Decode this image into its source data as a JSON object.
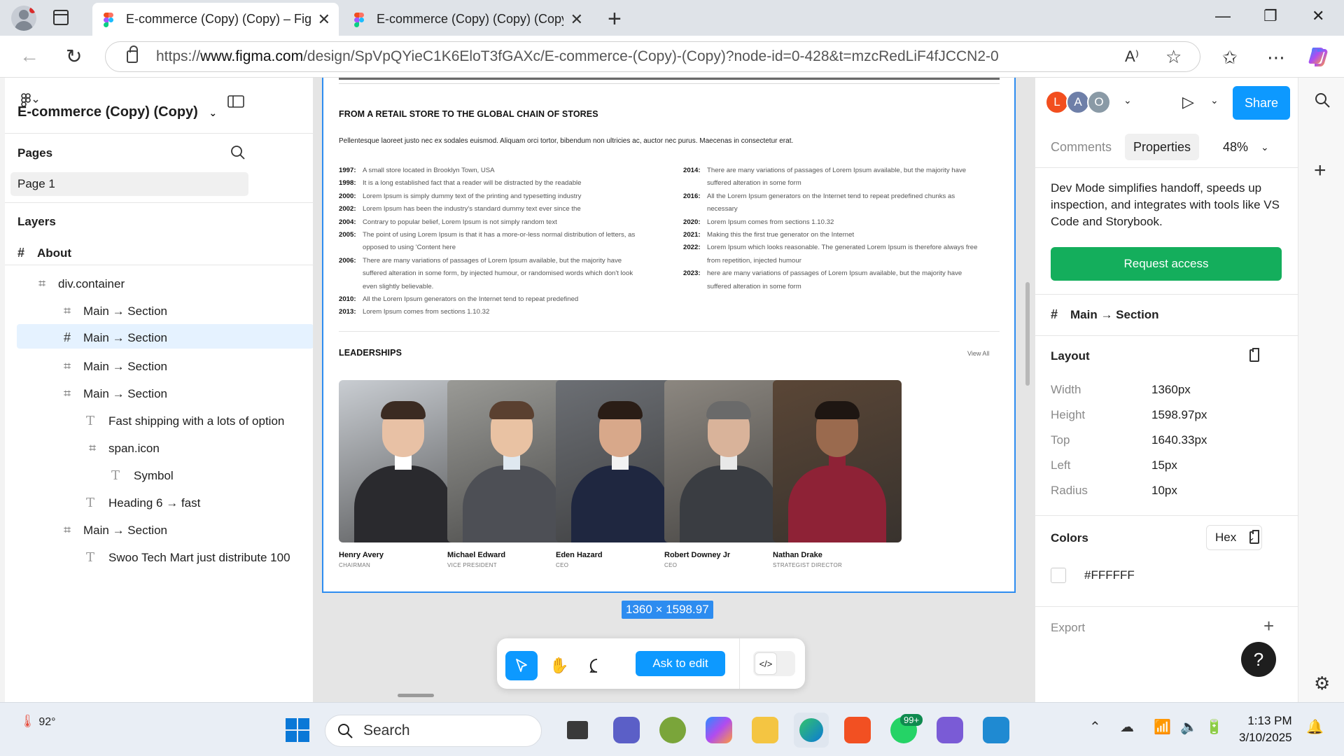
{
  "browser": {
    "tabs": [
      {
        "title": "E-commerce (Copy) (Copy) – Figma",
        "active": true
      },
      {
        "title": "E-commerce (Copy) (Copy) (Copy)",
        "active": false
      }
    ],
    "url_prefix": "https://",
    "url_host": "www.figma.com",
    "url_path": "/design/SpVpQYieC1K6EloT3fGAXc/E-commerce-(Copy)-(Copy)?node-id=0-428&t=mzcRedLiF4fJCCN2-0"
  },
  "left_panel": {
    "file_name": "E-commerce (Copy) (Copy)",
    "pages_header": "Pages",
    "current_page": "Page 1",
    "layers_header": "Layers",
    "root_layer": "About",
    "layers": [
      {
        "type": "frame",
        "label": "div.container"
      },
      {
        "type": "frame",
        "label": "Main → Section"
      },
      {
        "type": "frame",
        "label": "Main → Section"
      },
      {
        "type": "frame",
        "label": "Main → Section"
      },
      {
        "type": "frame",
        "label": "Main → Section"
      },
      {
        "type": "text",
        "label": "Fast shipping with a lots of option"
      },
      {
        "type": "frame",
        "label": "span.icon"
      },
      {
        "type": "text",
        "label": "Symbol"
      },
      {
        "type": "text",
        "label": "Heading 6 → fast"
      },
      {
        "type": "frame",
        "label": "Main → Section"
      },
      {
        "type": "text",
        "label": "Swoo Tech Mart just distribute 100"
      }
    ]
  },
  "canvas": {
    "heading": "FROM A RETAIL STORE TO THE GLOBAL CHAIN OF STORES",
    "lead": "Pellentesque laoreet justo nec ex sodales euismod. Aliquam orci tortor, bibendum non ultricies ac, auctor nec purus. Maecenas in consectetur erat.",
    "timeline_left": [
      {
        "year": "1997:",
        "text": "A small store located in Brooklyn Town, USA"
      },
      {
        "year": "1998:",
        "text": "It is a long established fact that a reader will be distracted by the readable"
      },
      {
        "year": "2000:",
        "text": "Lorem Ipsum is simply dummy text of the printing and typesetting industry"
      },
      {
        "year": "2002:",
        "text": "Lorem Ipsum has been the industry's standard dummy text ever since the"
      },
      {
        "year": "2004:",
        "text": "Contrary to popular belief, Lorem Ipsum is not simply random text"
      },
      {
        "year": "2005:",
        "text": "The point of using Lorem Ipsum is that it has a more-or-less normal distribution of letters, as opposed to using 'Content here"
      },
      {
        "year": "2006:",
        "text": "There are many variations of passages of Lorem Ipsum available, but the majority have suffered alteration in some form, by injected humour, or randomised words which don't look even slightly believable."
      },
      {
        "year": "2010:",
        "text": "All the Lorem Ipsum generators on the Internet tend to repeat predefined"
      },
      {
        "year": "2013:",
        "text": "Lorem Ipsum comes from sections 1.10.32"
      }
    ],
    "timeline_right": [
      {
        "year": "2014:",
        "text": "There are many variations of passages of Lorem Ipsum available, but the majority have suffered alteration in some form"
      },
      {
        "year": "2016:",
        "text": "All the Lorem Ipsum generators on the Internet tend to repeat predefined chunks as necessary"
      },
      {
        "year": "2020:",
        "text": "Lorem Ipsum comes from sections 1.10.32"
      },
      {
        "year": "2021:",
        "text": "Making this the first true generator on the Internet"
      },
      {
        "year": "2022:",
        "text": "Lorem Ipsum which looks reasonable. The generated Lorem Ipsum is therefore always free from repetition, injected humour"
      },
      {
        "year": "2023:",
        "text": "here are many variations of passages of Lorem Ipsum available, but the majority have suffered alteration in some form"
      }
    ],
    "leaderships_heading": "LEADERSHIPS",
    "view_all": "View All",
    "leaders": [
      {
        "name": "Henry Avery",
        "role": "CHAIRMAN",
        "jacket": "#2a2a2e",
        "shirt": "#ffffff",
        "bg": "#c9cdd2",
        "skin": "#e8c1a5",
        "hair": "#3b2b22"
      },
      {
        "name": "Michael Edward",
        "role": "VICE PRESIDENT",
        "jacket": "#4d4f55",
        "shirt": "#dfe8f0",
        "bg": "#9a9a96",
        "skin": "#e9c2a3",
        "hair": "#5a4030"
      },
      {
        "name": "Eden Hazard",
        "role": "CEO",
        "jacket": "#1f2740",
        "shirt": "#f2f2f2",
        "bg": "#6c6f74",
        "skin": "#d8a88a",
        "hair": "#2a1d16"
      },
      {
        "name": "Robert Downey Jr",
        "role": "CEO",
        "jacket": "#3a3d42",
        "shirt": "#e8e8e8",
        "bg": "#8c8780",
        "skin": "#d9b39a",
        "hair": "#6a6a6a"
      },
      {
        "name": "Nathan Drake",
        "role": "STRATEGIST DIRECTOR",
        "jacket": "#8e2236",
        "shirt": "#8e2236",
        "bg": "#5a4636",
        "skin": "#9a6a4e",
        "hair": "#1e1612"
      }
    ],
    "size_badge": "1360 × 1598.97",
    "ask_to_edit": "Ask to edit"
  },
  "right_panel": {
    "avatars": [
      {
        "letter": "L",
        "color": "#f24e1e"
      },
      {
        "letter": "A",
        "color": "#6e7fa8"
      },
      {
        "letter": "O",
        "color": "#8a9aa6"
      }
    ],
    "share": "Share",
    "tab_comments": "Comments",
    "tab_properties": "Properties",
    "zoom": "48%",
    "devmode_text": "Dev Mode simplifies handoff, speeds up inspection, and integrates with tools like VS Code and Storybook.",
    "request_access": "Request access",
    "selection_name": "Main → Section",
    "layout_header": "Layout",
    "props": [
      {
        "label": "Width",
        "value": "1360px"
      },
      {
        "label": "Height",
        "value": "1598.97px"
      },
      {
        "label": "Top",
        "value": "1640.33px"
      },
      {
        "label": "Left",
        "value": "15px"
      },
      {
        "label": "Radius",
        "value": "10px"
      }
    ],
    "colors_header": "Colors",
    "color_format": "Hex",
    "color_value": "#FFFFFF",
    "export_header": "Export"
  },
  "taskbar": {
    "temperature": "92°",
    "search_placeholder": "Search",
    "notification_badge": "99+",
    "time": "1:13 PM",
    "date": "3/10/2025"
  }
}
